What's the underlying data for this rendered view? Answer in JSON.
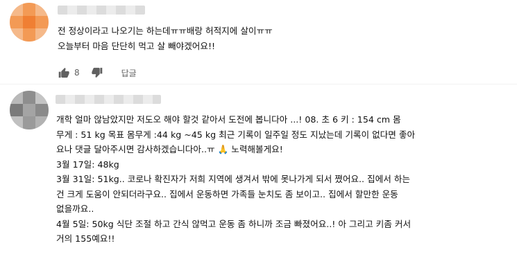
{
  "colors": {
    "text": "#111111",
    "meta": "#606060",
    "avatar_1": [
      "#f5b98a",
      "#f39a55",
      "#f5b98a",
      "#f39a55",
      "#f07f33",
      "#f39a55",
      "#f5b98a",
      "#f39a55",
      "#f5b98a"
    ],
    "avatar_2": [
      "#b9b9b9",
      "#8e8e8e",
      "#c4c4c4",
      "#7a7a7a",
      "#a4a4a4",
      "#8a8a8a",
      "#c0c0c0",
      "#9a9a9a",
      "#b2b2b2"
    ]
  },
  "comment_1": {
    "lines": [
      "전 정상이라고 나오기는 하는데ㅠㅠ배랑 허적지에 살이ㅠㅠ",
      "오늘부터 마음 단단히 먹고 살 빼야겠어요!!"
    ],
    "likes": "8",
    "like_icon": "thumbs-up-icon",
    "dislike_icon": "thumbs-down-icon",
    "reply_label": "답글"
  },
  "comment_2": {
    "lines": [
      "개학 얼마 않남았지만 저도오 해야 할것 같아서 도전에 봅니다아 ...!   08.  초 6    키 : 154 cm 몸",
      "무게 : 51 kg  목표 몸무게 :44 kg ~45 kg 최근 기록이 일주일 정도 지났는데 기록이 없다면  좋아",
      "요나 댓글 달아주시면 감사하겠습니다아..ㅠ 🙏   노력해볼게요!",
      "3월 17일: 48kg",
      "3월 31일: 51kg.. 코로나 확진자가 저희 지역에 생겨서 밖에 못나가게 되서 쪘어요.. 집에서 하는",
      "건 크게 도움이 안되더라구요.. 집에서 운동하면 가족들 눈치도 좀 보이고.. 집에서 할만한 운동",
      "없을까요..",
      "4월 5일: 50kg 식단 조절 하고 간식 않먹고 운동 좀 하니까 조금 빠졌어요..! 아 그리고 키좀 커서",
      "거의 155예요!!"
    ]
  }
}
